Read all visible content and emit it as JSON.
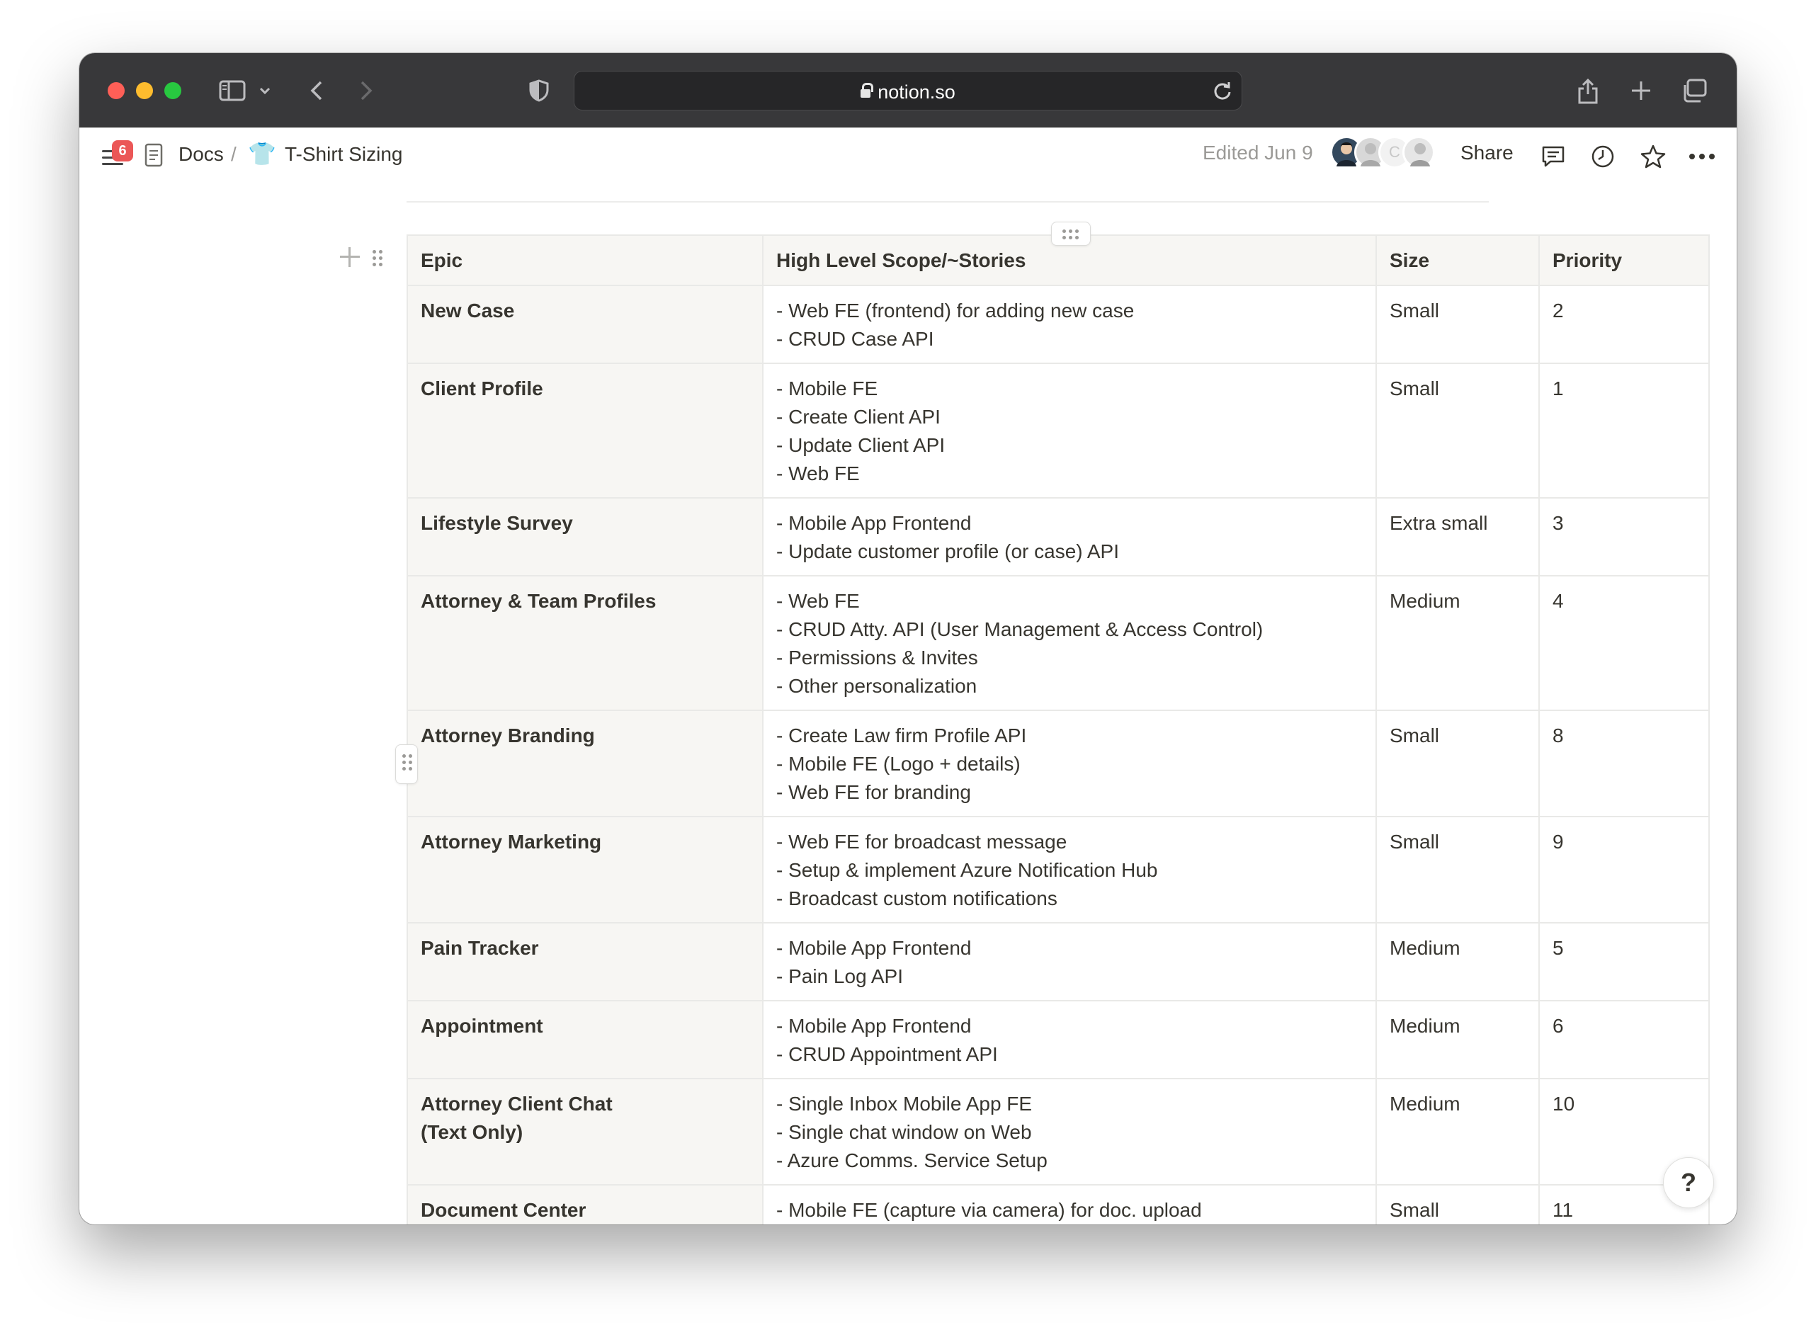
{
  "browser": {
    "url": "notion.so"
  },
  "header": {
    "notification_count": "6",
    "breadcrumb_parent": "Docs",
    "breadcrumb_separator": "/",
    "page_icon": "👕",
    "page_title": "T-Shirt Sizing",
    "edited": "Edited Jun 9",
    "share_label": "Share",
    "avatar_initial": "C"
  },
  "table": {
    "headers": [
      "Epic",
      "High Level Scope/~Stories",
      "Size",
      "Priority"
    ],
    "rows": [
      {
        "epic": "New Case",
        "scope": "- Web FE (frontend) for adding new case\n- CRUD Case API",
        "size": "Small",
        "priority": "2"
      },
      {
        "epic": "Client Profile",
        "scope": "- Mobile FE\n- Create Client API\n- Update Client API\n- Web FE",
        "size": "Small",
        "priority": "1"
      },
      {
        "epic": "Lifestyle Survey",
        "scope": "- Mobile App Frontend\n- Update customer profile (or case) API",
        "size": "Extra small",
        "priority": "3"
      },
      {
        "epic": "Attorney & Team Profiles",
        "scope": "- Web FE\n- CRUD Atty. API (User Management & Access Control)\n- Permissions & Invites\n- Other personalization",
        "size": "Medium",
        "priority": "4"
      },
      {
        "epic": "Attorney Branding",
        "scope": "- Create Law firm Profile API\n- Mobile FE (Logo + details)\n- Web FE for branding",
        "size": "Small",
        "priority": "8"
      },
      {
        "epic": "Attorney Marketing",
        "scope": "- Web FE for broadcast message\n- Setup & implement Azure Notification Hub\n- Broadcast custom notifications",
        "size": "Small",
        "priority": "9"
      },
      {
        "epic": "Pain Tracker",
        "scope": "- Mobile App Frontend\n- Pain Log API",
        "size": "Medium",
        "priority": "5"
      },
      {
        "epic": "Appointment",
        "scope": "- Mobile App Frontend\n- CRUD Appointment API",
        "size": "Medium",
        "priority": "6"
      },
      {
        "epic": "Attorney Client Chat\n(Text Only)",
        "scope": "- Single Inbox Mobile App FE\n- Single chat window on Web\n- Azure Comms. Service Setup",
        "size": "Medium",
        "priority": "10"
      },
      {
        "epic": "Document Center",
        "scope": "- Mobile FE (capture via camera) for doc. upload",
        "size": "Small",
        "priority": "11"
      }
    ]
  },
  "help_label": "?"
}
